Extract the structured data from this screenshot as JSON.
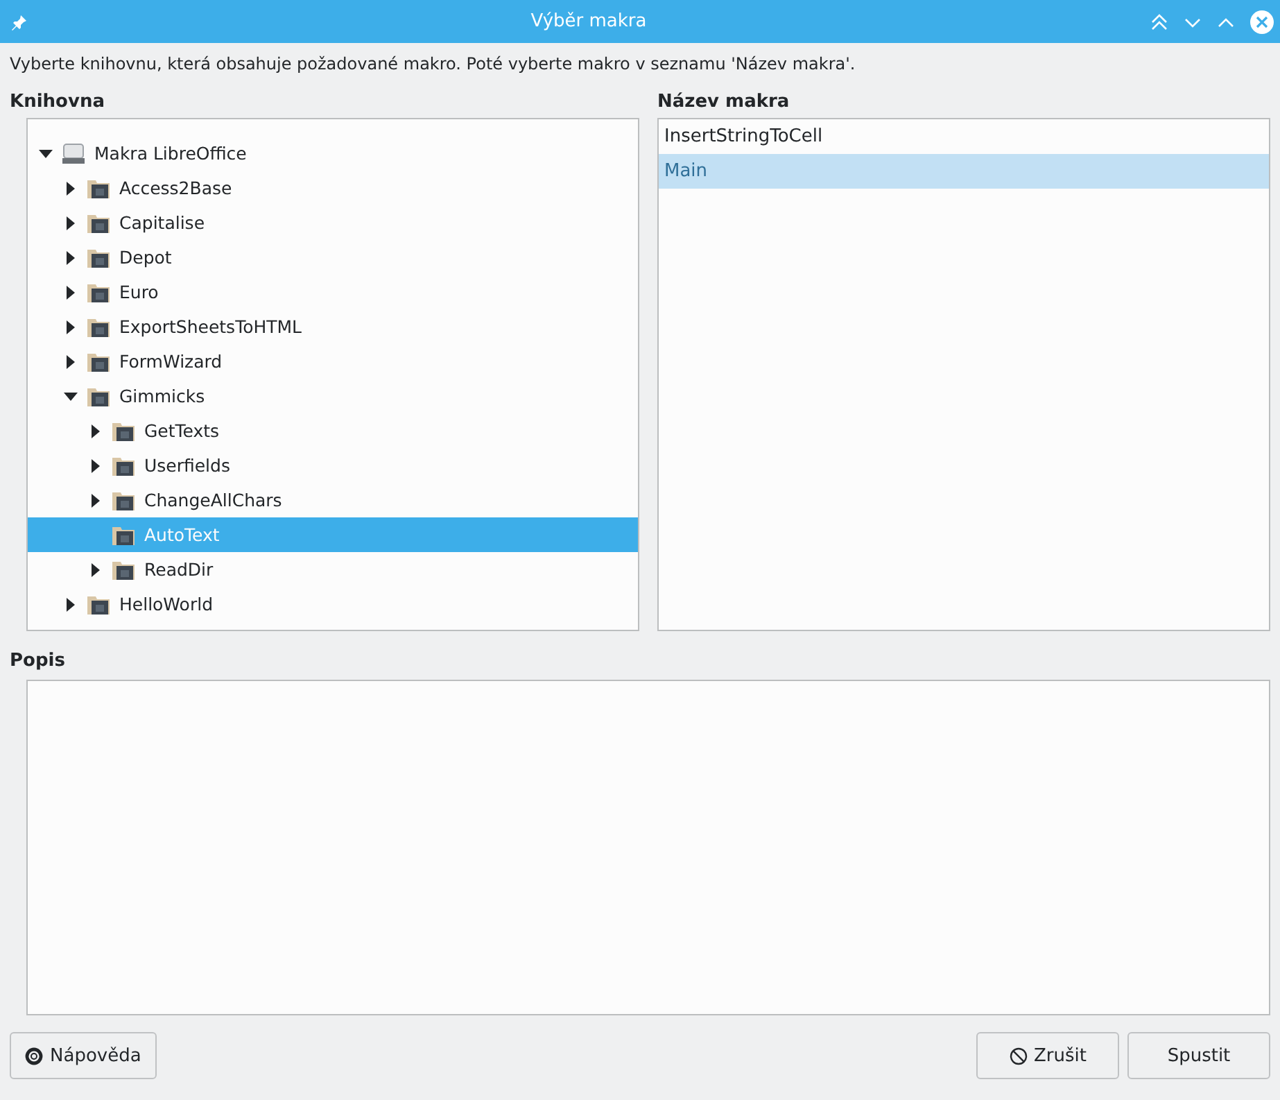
{
  "window": {
    "title": "Výběr makra"
  },
  "instruction": "Vyberte knihovnu, která obsahuje požadované makro. Poté vyberte makro v seznamu 'Název makra'.",
  "library": {
    "label": "Knihovna",
    "tree": [
      {
        "label": "Makra LibreOffice",
        "kind": "drive",
        "expandable": true,
        "expanded": true,
        "selected": false,
        "children": [
          {
            "label": "Access2Base",
            "kind": "folder",
            "expandable": true,
            "expanded": false,
            "selected": false
          },
          {
            "label": "Capitalise",
            "kind": "folder",
            "expandable": true,
            "expanded": false,
            "selected": false
          },
          {
            "label": "Depot",
            "kind": "folder",
            "expandable": true,
            "expanded": false,
            "selected": false
          },
          {
            "label": "Euro",
            "kind": "folder",
            "expandable": true,
            "expanded": false,
            "selected": false
          },
          {
            "label": "ExportSheetsToHTML",
            "kind": "folder",
            "expandable": true,
            "expanded": false,
            "selected": false
          },
          {
            "label": "FormWizard",
            "kind": "folder",
            "expandable": true,
            "expanded": false,
            "selected": false
          },
          {
            "label": "Gimmicks",
            "kind": "folder",
            "expandable": true,
            "expanded": true,
            "selected": false,
            "children": [
              {
                "label": "GetTexts",
                "kind": "folder",
                "expandable": true,
                "expanded": false,
                "selected": false
              },
              {
                "label": "Userfields",
                "kind": "folder",
                "expandable": true,
                "expanded": false,
                "selected": false
              },
              {
                "label": "ChangeAllChars",
                "kind": "folder",
                "expandable": true,
                "expanded": false,
                "selected": false
              },
              {
                "label": "AutoText",
                "kind": "folder",
                "expandable": false,
                "selected": true
              },
              {
                "label": "ReadDir",
                "kind": "folder",
                "expandable": true,
                "expanded": false,
                "selected": false
              }
            ]
          },
          {
            "label": "HelloWorld",
            "kind": "folder",
            "expandable": true,
            "expanded": false,
            "selected": false
          }
        ]
      }
    ]
  },
  "macros": {
    "label": "Název makra",
    "items": [
      {
        "label": "InsertStringToCell",
        "selected": false
      },
      {
        "label": "Main",
        "selected": true
      }
    ]
  },
  "description": {
    "label": "Popis"
  },
  "buttons": [
    {
      "label": "Nápověda",
      "kind": "help"
    },
    {
      "label": "Zrušit",
      "kind": "cancel"
    },
    {
      "label": "Spustit",
      "kind": "run"
    }
  ]
}
